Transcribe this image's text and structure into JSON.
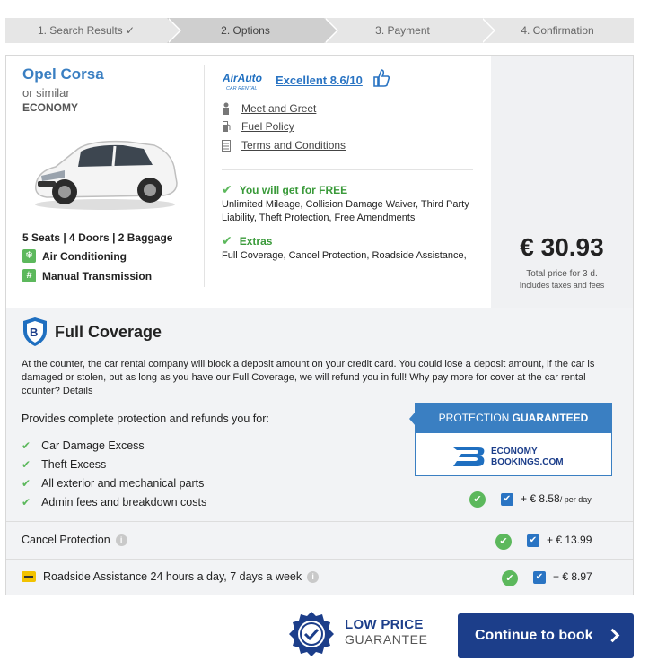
{
  "steps": [
    {
      "label": "1. Search Results",
      "done": "✓"
    },
    {
      "label": "2. Options"
    },
    {
      "label": "3. Payment"
    },
    {
      "label": "4. Confirmation"
    }
  ],
  "car": {
    "title": "Opel Corsa",
    "similar": "or similar",
    "class": "ECONOMY",
    "specs": "5 Seats | 4 Doors | 2 Baggage",
    "feature1": "Air Conditioning",
    "feature2": "Manual Transmission"
  },
  "supplier": {
    "logo_line1": "AirAuto",
    "logo_line2": "CAR RENTAL",
    "rating": "Excellent 8.6/10",
    "links": [
      "Meet and Greet",
      "Fuel Policy",
      "Terms and Conditions"
    ]
  },
  "free": {
    "heading": "You will get for FREE",
    "text": "Unlimited Mileage, Collision Damage Waiver, Third Party Liability, Theft Protection, Free Amendments"
  },
  "extras": {
    "heading": "Extras",
    "text": "Full Coverage, Cancel Protection, Roadside Assistance,"
  },
  "price": {
    "amount": "€ 30.93",
    "label": "Total price for 3 d.",
    "note": "Includes taxes and fees"
  },
  "coverage": {
    "title": "Full Coverage",
    "description": "At the counter, the car rental company will block a deposit amount on your credit card. You could lose a deposit amount, if the car is damaged or stolen, but as long as you have our Full Coverage, we will refund you in full! Why pay more for cover at the car rental counter?",
    "details_link": "Details",
    "provides": "Provides complete protection and refunds you for:",
    "items": [
      "Car Damage Excess",
      "Theft Excess",
      "All exterior and mechanical parts",
      "Admin fees and breakdown costs"
    ],
    "guarantee_prefix": "PROTECTION",
    "guarantee_bold": "GUARANTEED",
    "brand_line1": "ECONOMY",
    "brand_line2": "BOOKINGS",
    "brand_suffix": ".COM",
    "price": "+ € 8.58",
    "per": "/ per day"
  },
  "options": [
    {
      "label": "Cancel Protection",
      "price": "+ € 13.99"
    },
    {
      "label": "Roadside Assistance 24 hours a day, 7 days a week",
      "price": "+ € 8.97"
    }
  ],
  "footer": {
    "badge_line1": "LOW PRICE",
    "badge_line2": "GUARANTEE",
    "cta": "Continue to book"
  },
  "colors": {
    "link_blue": "#2a74c3",
    "title_blue": "#3a7fc2",
    "cta_navy": "#1c3e8a",
    "green": "#5cb85c",
    "panel_gray": "#f2f3f5"
  }
}
